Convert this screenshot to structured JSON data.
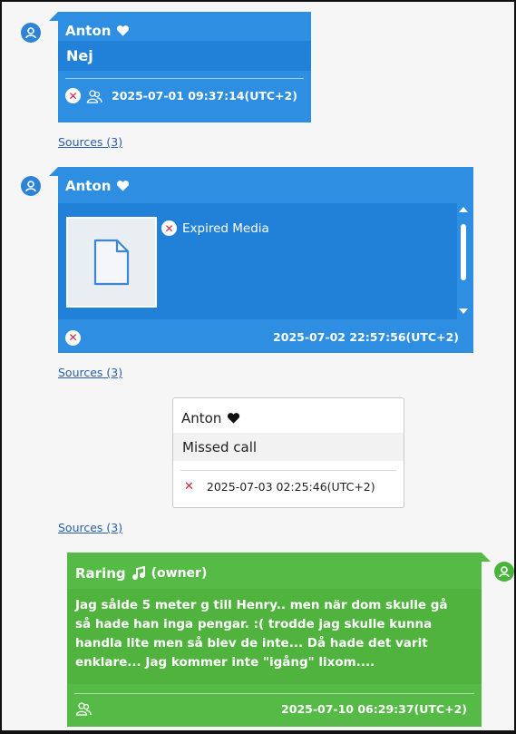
{
  "messages": [
    {
      "sender": "Anton",
      "text": "Nej",
      "timestamp": "2025-07-01 09:37:14(UTC+2)"
    },
    {
      "sender": "Anton",
      "media_status": "Expired Media",
      "timestamp": "2025-07-02 22:57:56(UTC+2)"
    },
    {
      "sender": "Anton",
      "text": "Missed call",
      "timestamp": "2025-07-03 02:25:46(UTC+2)"
    },
    {
      "sender": "Raring",
      "role": "(owner)",
      "text": "Jag sålde 5 meter g till Henry.. men när dom skulle gå så hade han inga pengar. :( trodde jag skulle kunna handla lite men så blev de inte... Då hade det varit enklare... Jag kommer inte \"igång\" lixom....",
      "timestamp": "2025-07-10 06:29:37(UTC+2)"
    }
  ],
  "sources_label": "Sources (3)",
  "colors": {
    "incoming": "#2e8ee1",
    "outgoing": "#56bb46",
    "avatar_blue": "#2d84d6",
    "avatar_green": "#48b43c",
    "error": "#d0243a"
  },
  "icons": [
    "user-avatar-icon",
    "heart-icon",
    "delete-x-icon",
    "participants-icon",
    "file-icon",
    "music-note-icon"
  ]
}
